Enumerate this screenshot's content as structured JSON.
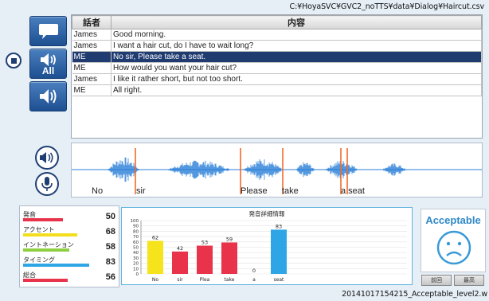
{
  "file_path": "C:¥HoyaSVC¥GVC2_noTTS¥data¥Dialog¥Haircut.csv",
  "controls": {
    "all_label": "All"
  },
  "dialog": {
    "headers": [
      "話者",
      "内容"
    ],
    "rows": [
      {
        "speaker": "James",
        "content": "Good morning.",
        "selected": false
      },
      {
        "speaker": "James",
        "content": "I want a hair cut, do I have to wait long?",
        "selected": false
      },
      {
        "speaker": "ME",
        "content": "No sir, Please take a seat.",
        "selected": true
      },
      {
        "speaker": "ME",
        "content": "How would you want your hair cut?",
        "selected": false
      },
      {
        "speaker": "James",
        "content": "I like it rather short, but not too short.",
        "selected": false
      },
      {
        "speaker": "ME",
        "content": "All right.",
        "selected": false
      }
    ]
  },
  "waveform": {
    "words": [
      "No",
      "sir",
      "Please",
      "take",
      "a seat"
    ]
  },
  "scores": [
    {
      "name": "発音",
      "value": "50",
      "color": "#e8334a",
      "fraction": 0.5
    },
    {
      "name": "アクセント",
      "value": "68",
      "color": "#f2de1b",
      "fraction": 0.68
    },
    {
      "name": "イントネーション",
      "value": "58",
      "color": "#8ecf43",
      "fraction": 0.58
    },
    {
      "name": "タイミング",
      "value": "83",
      "color": "#2ea6e6",
      "fraction": 0.83
    },
    {
      "name": "総合",
      "value": "56",
      "color": "#e8334a",
      "fraction": 0.56
    }
  ],
  "chart_data": {
    "type": "bar",
    "title": "発音詳細情報",
    "categories": [
      "No",
      "sir",
      "Plea",
      "take",
      "a",
      "seat"
    ],
    "values": [
      62,
      42,
      53,
      59,
      0,
      83
    ],
    "colors": [
      "#f5e31c",
      "#e8334a",
      "#e8334a",
      "#e8334a",
      "#e8334a",
      "#2ea6e6"
    ],
    "yticks": [
      0,
      10,
      20,
      30,
      40,
      50,
      60,
      70,
      80,
      90,
      100
    ],
    "ylim": [
      0,
      100
    ]
  },
  "result": {
    "label": "Acceptable",
    "prev_label": "前回",
    "best_label": "最高"
  },
  "footer_file": "20141017154215_Acceptable_level2.w"
}
